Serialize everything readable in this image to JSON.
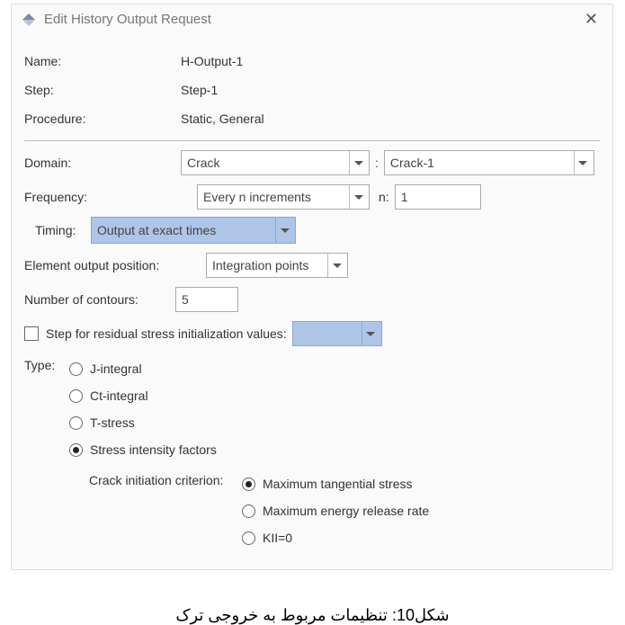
{
  "title": "Edit History Output Request",
  "name_label": "Name:",
  "name_value": "H-Output-1",
  "step_label": "Step:",
  "step_value": "Step-1",
  "procedure_label": "Procedure:",
  "procedure_value": "Static, General",
  "domain_label": "Domain:",
  "domain_select": "Crack",
  "domain_name": "Crack-1",
  "frequency_label": "Frequency:",
  "frequency_select": "Every n increments",
  "n_label": "n:",
  "n_value": "1",
  "timing_label": "Timing:",
  "timing_select": "Output at exact times",
  "eop_label": "Element output position:",
  "eop_select": "Integration points",
  "contours_label": "Number of contours:",
  "contours_value": "5",
  "residual_label": "Step for residual stress initialization values:",
  "type_label": "Type:",
  "type_options": {
    "j": "J-integral",
    "ct": "Ct-integral",
    "t": "T-stress",
    "sif": "Stress intensity factors"
  },
  "cic_label": "Crack initiation criterion:",
  "cic_options": {
    "mts": "Maximum tangential stress",
    "merr": "Maximum energy release rate",
    "kii": "KII=0"
  },
  "caption": "شکل10: تنظیمات مربوط به خروجی ترک"
}
